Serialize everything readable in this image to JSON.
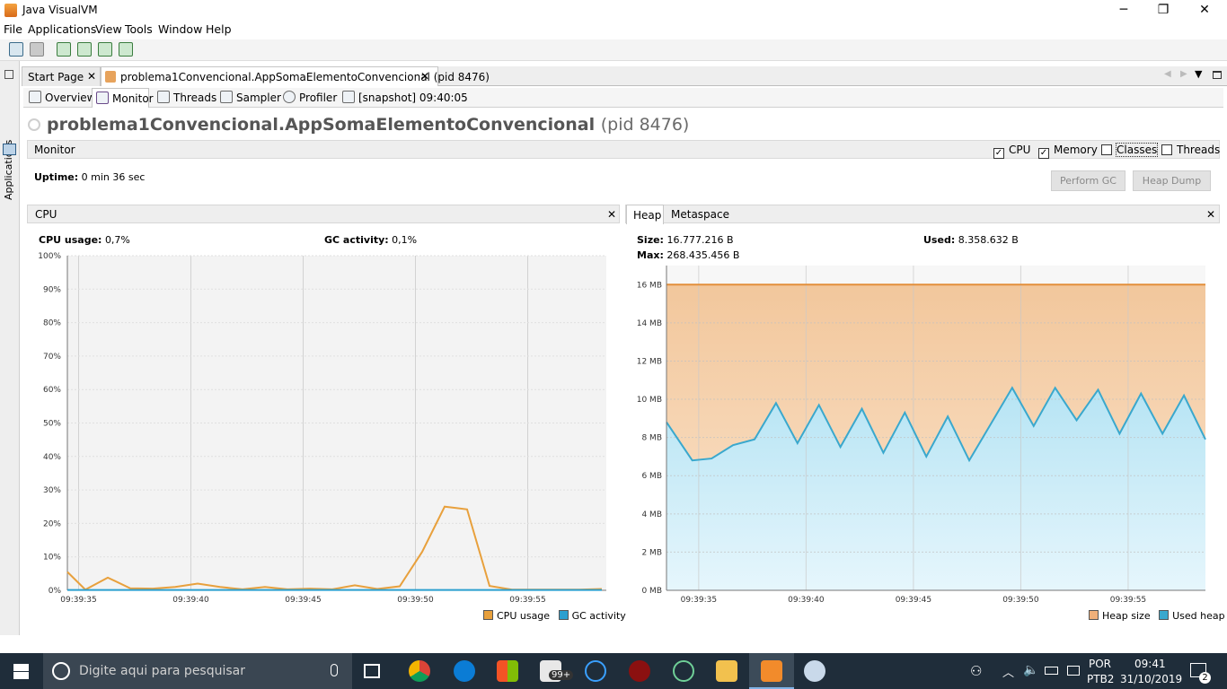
{
  "window": {
    "title": "Java VisualVM",
    "minimize": "─",
    "restore": "❐",
    "close": "✕"
  },
  "menu": [
    "File",
    "Applications",
    "View",
    "Tools",
    "Window",
    "Help"
  ],
  "sidebar": {
    "label": "Applications"
  },
  "doc_tabs": [
    {
      "label": "Start Page"
    },
    {
      "label": "problema1Convencional.AppSomaElementoConvencional (pid 8476)"
    }
  ],
  "sub_tabs": [
    "Overview",
    "Monitor",
    "Threads",
    "Sampler",
    "Profiler",
    "[snapshot] 09:40:05"
  ],
  "process": {
    "name": "problema1Convencional.AppSomaElementoConvencional",
    "pid": "(pid 8476)"
  },
  "monitor": {
    "label": "Monitor",
    "checkboxes": [
      {
        "label": "CPU",
        "checked": true
      },
      {
        "label": "Memory",
        "checked": true
      },
      {
        "label": "Classes",
        "checked": false
      },
      {
        "label": "Threads",
        "checked": false
      }
    ],
    "uptime_label": "Uptime:",
    "uptime_value": "0 min 36 sec",
    "perform_gc": "Perform GC",
    "heap_dump": "Heap Dump"
  },
  "cpu_panel": {
    "title": "CPU",
    "usage_label": "CPU usage:",
    "usage_value": "0,7%",
    "gc_label": "GC activity:",
    "gc_value": "0,1%",
    "legend_cpu": "CPU usage",
    "legend_gc": "GC activity"
  },
  "heap_panel": {
    "tab_heap": "Heap",
    "tab_meta": "Metaspace",
    "size_label": "Size:",
    "size_value": "16.777.216 B",
    "used_label": "Used:",
    "used_value": "8.358.632 B",
    "max_label": "Max:",
    "max_value": "268.435.456 B",
    "legend_size": "Heap size",
    "legend_used": "Used heap"
  },
  "chart_data": [
    {
      "type": "line",
      "y_ticks": [
        "100%",
        "90%",
        "80%",
        "70%",
        "60%",
        "50%",
        "40%",
        "30%",
        "20%",
        "10%",
        "0%"
      ],
      "x_ticks": [
        "09:39:35",
        "09:39:40",
        "09:39:45",
        "09:39:50",
        "09:39:55"
      ],
      "ylim": [
        0,
        100
      ],
      "series": [
        {
          "name": "CPU usage",
          "color": "#e8a03c",
          "x": [
            0,
            0.8,
            1.8,
            2.8,
            3.8,
            4.8,
            5.8,
            6.8,
            7.8,
            8.8,
            9.8,
            10.8,
            11.8,
            12.8,
            13.8,
            14.8,
            15.8,
            16.8,
            17.8,
            18.8,
            19.8,
            20.8,
            21.8,
            22.8,
            23.8
          ],
          "values": [
            5.5,
            0.2,
            3.8,
            0.6,
            0.5,
            1.0,
            2.0,
            1.0,
            0.3,
            1.0,
            0.3,
            0.5,
            0.3,
            1.5,
            0.4,
            1.2,
            11.5,
            25.0,
            24.2,
            1.3,
            0.2,
            0.2,
            0.2,
            0.2,
            0.4
          ]
        },
        {
          "name": "GC activity",
          "color": "#2b9fcf",
          "x": [
            0,
            23.8
          ],
          "values": [
            0.1,
            0.1
          ]
        }
      ]
    },
    {
      "type": "area",
      "y_ticks": [
        "16 MB",
        "14 MB",
        "12 MB",
        "10 MB",
        "8 MB",
        "6 MB",
        "4 MB",
        "2 MB",
        "0 MB"
      ],
      "x_ticks": [
        "09:39:35",
        "09:39:40",
        "09:39:45",
        "09:39:50",
        "09:39:55"
      ],
      "ylim": [
        0,
        17
      ],
      "series": [
        {
          "name": "Heap size",
          "color": "#f0b07a",
          "x": [
            0,
            25.5
          ],
          "values": [
            16,
            16
          ]
        },
        {
          "name": "Used heap",
          "color": "#3aa8cd",
          "x": [
            0,
            1.2,
            2.1,
            3.1,
            4.1,
            5.1,
            6.1,
            7.1,
            8.1,
            9.1,
            10.1,
            11.1,
            12.1,
            13.1,
            14.1,
            15.1,
            16.1,
            17.1,
            18.1,
            19.1,
            20.1,
            21.1,
            22.1,
            23.1,
            24.1,
            25.1
          ],
          "values": [
            8.8,
            6.8,
            6.9,
            7.6,
            7.9,
            9.8,
            7.7,
            9.7,
            7.5,
            9.5,
            7.2,
            9.3,
            7.0,
            9.1,
            6.8,
            8.7,
            10.6,
            8.6,
            10.6,
            8.9,
            10.5,
            8.2,
            10.3,
            8.2,
            10.2,
            7.9
          ]
        }
      ]
    }
  ],
  "taskbar": {
    "search_placeholder": "Digite aqui para pesquisar",
    "badge": "99+",
    "lang1": "POR",
    "lang2": "PTB2",
    "time": "09:41",
    "date": "31/10/2019",
    "notif": "2"
  }
}
